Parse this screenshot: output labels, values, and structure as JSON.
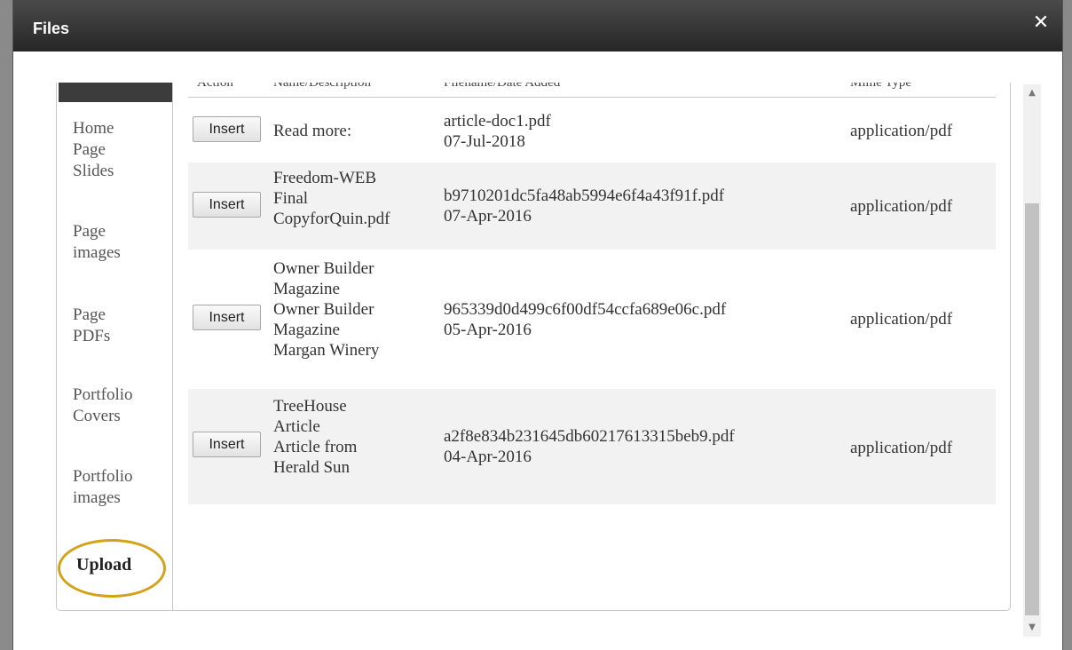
{
  "dialog": {
    "title": "Files",
    "close_label": "✕"
  },
  "sidebar": {
    "items": [
      {
        "label": "Home\nPage\nSlides"
      },
      {
        "label": "Page\nimages"
      },
      {
        "label": "Page\nPDFs"
      },
      {
        "label": "Portfolio\nCovers"
      },
      {
        "label": "Portfolio\nimages"
      }
    ],
    "upload_label": "Upload"
  },
  "table": {
    "headers": [
      "Action",
      "Name/Description",
      "Filename/Date Added",
      "Mime Type"
    ],
    "rows": [
      {
        "button": "Insert",
        "name": "Read more:",
        "filename": "article-doc1.pdf",
        "date": "07-Jul-2018",
        "mime": "application/pdf"
      },
      {
        "button": "Insert",
        "name": "Freedom-WEB\nFinal\nCopyforQuin.pdf",
        "filename": "b9710201dc5fa48ab5994e6f4a43f91f.pdf",
        "date": "07-Apr-2016",
        "mime": "application/pdf"
      },
      {
        "button": "Insert",
        "name": "Owner Builder\nMagazine\nOwner Builder\nMagazine\nMargan Winery",
        "filename": "965339d0d499c6f00df54ccfa689e06c.pdf",
        "date": "05-Apr-2016",
        "mime": "application/pdf"
      },
      {
        "button": "Insert",
        "name": "TreeHouse\nArticle\nArticle from\nHerald Sun",
        "filename": "a2f8e834b231645db60217613315beb9.pdf",
        "date": "04-Apr-2016",
        "mime": "application/pdf"
      }
    ]
  },
  "scrollbar": {
    "up_arrow": "▲",
    "down_arrow": "▼"
  },
  "colors": {
    "titlebar": "#333333",
    "highlight_ring": "#d4a21a",
    "alt_row": "#f2f2f2"
  }
}
